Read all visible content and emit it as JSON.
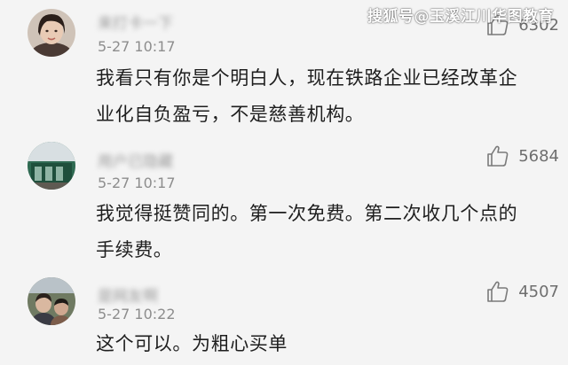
{
  "watermark": "搜狐号@玉溪江川华图教育",
  "comments": [
    {
      "username": "来打卡一下",
      "timestamp": "5-27 10:17",
      "like_count": "6302",
      "lines": [
        "我看只有你是个明白人，现在铁路企业已经改革企",
        "业化自负盈亏，不是慈善机构。"
      ]
    },
    {
      "username": "用户已隐藏",
      "timestamp": "5-27 10:17",
      "like_count": "5684",
      "lines": [
        "我觉得挺赞同的。第一次免费。第二次收几个点的",
        "手续费。"
      ]
    },
    {
      "username": "是网友啊",
      "timestamp": "5-27 10:22",
      "like_count": "4507",
      "lines": [
        "这个可以。为粗心买单"
      ]
    }
  ],
  "colors": {
    "background": "#f4f4f4",
    "text": "#1e1e1e",
    "meta": "#8d8d8d",
    "icon": "#7a7a7a"
  },
  "icons": {
    "like": "thumbs-up-icon",
    "avatar": "user-avatar"
  }
}
